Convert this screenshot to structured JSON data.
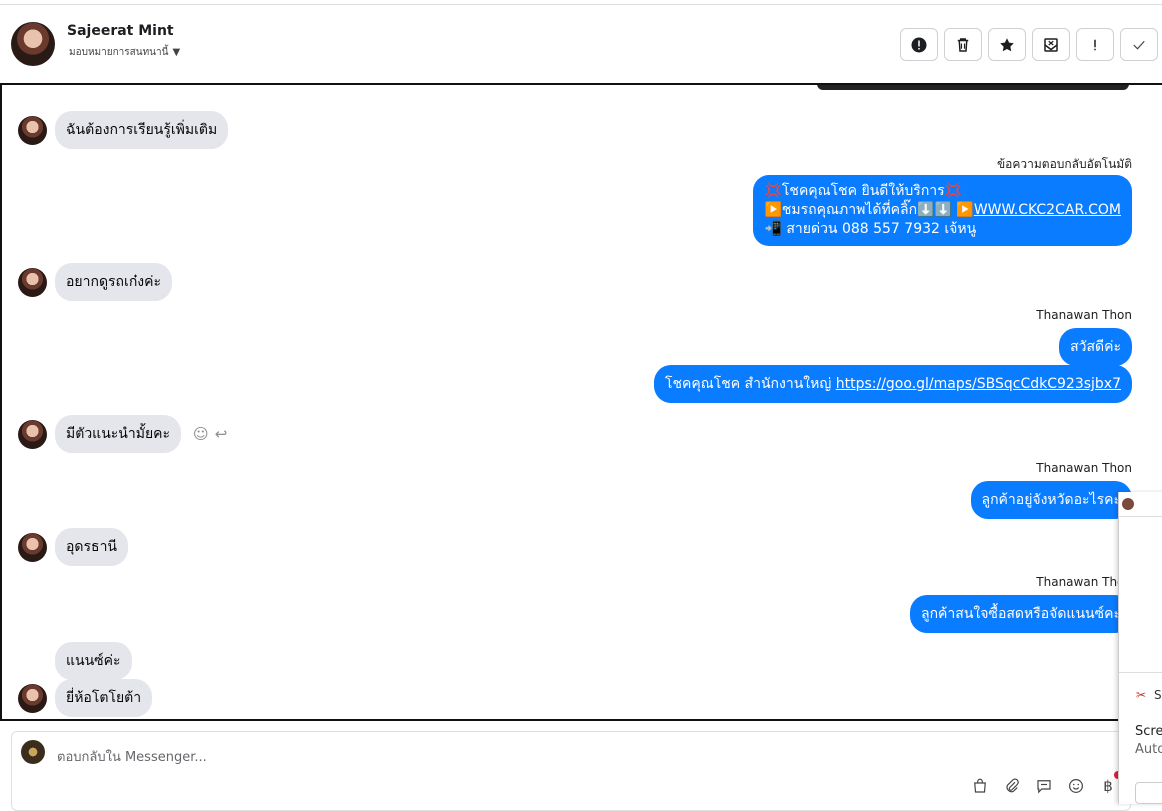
{
  "header": {
    "user_name": "Sajeerat Mint",
    "assign_label": "มอบหมายการสนทนานี้"
  },
  "toolbar": {
    "buttons": [
      {
        "name": "report-button",
        "icon": "alert-circle-icon"
      },
      {
        "name": "delete-button",
        "icon": "trash-icon"
      },
      {
        "name": "star-button",
        "icon": "star-icon"
      },
      {
        "name": "mark-unread-button",
        "icon": "envelope-x-icon"
      },
      {
        "name": "important-button",
        "icon": "exclamation-icon"
      },
      {
        "name": "done-button",
        "icon": "check-icon"
      }
    ]
  },
  "messages": {
    "m1": "ฉันต้องการเรียนรู้เพิ่มเติม",
    "auto_reply_label": "ข้อความตอบกลับอัตโนมัติ",
    "auto_line1": "💢โชคคุณโชค ยินดีให้บริการ💢",
    "auto_line2_text": "▶️ชมรถคุณภาพได้ที่คลิ๊ก⬇️⬇️      ▶️",
    "auto_line2_link": "WWW.CKC2CAR.COM",
    "auto_line3": "📲 สายด่วน 088 557 7932 เจ้หนู",
    "m2": "อยากดูรถเก๋งค่ะ",
    "sender1": "Thanawan Thon",
    "r1": "สวัสดีค่ะ",
    "r2_text": "โชคคุณโชค สำนักงานใหญ่ ",
    "r2_link": "https://goo.gl/maps/SBSqcCdkC923sjbx7",
    "m3": "มีตัวแนะนำมั้ยคะ",
    "sender2": "Thanawan Thon",
    "r3": "ลูกค้าอยู่จังหวัดอะไรคะ",
    "m4": "อุดรธานี",
    "sender3": "Thanawan Thon",
    "r4": "ลูกค้าสนใจซื้อสดหรือจัดแนนซ์คะ",
    "m5": "แนนซ์ค่ะ",
    "m6": "ยี่ห้อโตโยต้า"
  },
  "overlay": {
    "s_label": "S",
    "line1": "Scre",
    "line2": "Auto"
  },
  "composer": {
    "placeholder": "ตอบกลับใน Messenger..."
  },
  "colors": {
    "outgoing_bubble": "#0a7cff",
    "incoming_bubble": "#e4e6eb"
  }
}
